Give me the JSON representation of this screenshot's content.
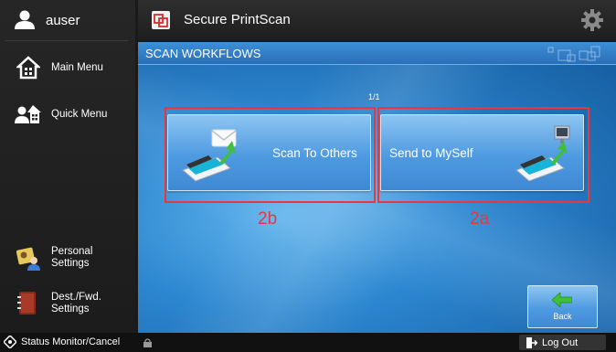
{
  "sidebar": {
    "user": "auser",
    "main_menu": "Main Menu",
    "quick_menu": "Quick Menu",
    "personal_settings_1": "Personal",
    "personal_settings_2": "Settings",
    "dest_fwd_1": "Dest./Fwd.",
    "dest_fwd_2": "Settings"
  },
  "topbar": {
    "app_title": "Secure PrintScan"
  },
  "main": {
    "section_title": "SCAN WORKFLOWS",
    "page_indicator": "1/1",
    "buttons": [
      {
        "label": "Scan To Others",
        "annotation": "2b"
      },
      {
        "label": "Send to MySelf",
        "annotation": "2a"
      }
    ],
    "back_label": "Back"
  },
  "statusbar": {
    "status_monitor": "Status Monitor/Cancel",
    "log_out": "Log Out"
  },
  "colors": {
    "accent_blue": "#2c86cf",
    "annotation_red": "#e8373d"
  }
}
